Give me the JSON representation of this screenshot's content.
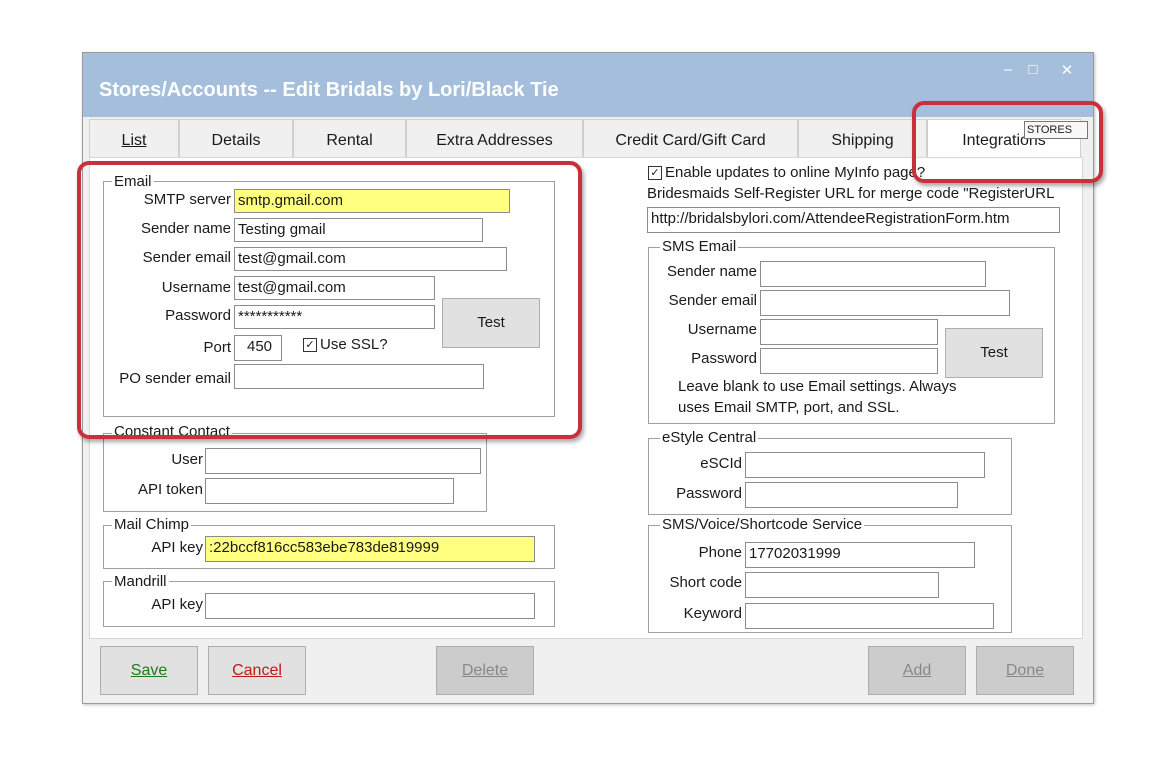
{
  "window": {
    "title": "Stores/Accounts -- Edit Bridals by Lori/Black Tie",
    "minimize_glyph": "–",
    "maximize_glyph": "□",
    "close_glyph": "✕"
  },
  "tabs": [
    {
      "label": "List"
    },
    {
      "label": "Details"
    },
    {
      "label": "Rental"
    },
    {
      "label": "Extra Addresses"
    },
    {
      "label": "Credit Card/Gift Card"
    },
    {
      "label": "Shipping"
    },
    {
      "label": "Integrations"
    }
  ],
  "tooltip": "STORES",
  "email": {
    "group_label": "Email",
    "smtp_label": "SMTP server",
    "smtp_value": "smtp.gmail.com",
    "sender_name_label": "Sender name",
    "sender_name_value": "Testing gmail",
    "sender_email_label": "Sender email",
    "sender_email_value": "test@gmail.com",
    "username_label": "Username",
    "username_value": "test@gmail.com",
    "password_label": "Password",
    "password_value": "***********",
    "test_label": "Test",
    "port_label": "Port",
    "port_value": "450",
    "ssl_label": "Use SSL?",
    "ssl_checked": true,
    "po_label": "PO sender email",
    "po_value": ""
  },
  "constant_contact": {
    "group_label": "Constant Contact",
    "user_label": "User",
    "user_value": "",
    "token_label": "API token",
    "token_value": ""
  },
  "mailchimp": {
    "group_label": "Mail Chimp",
    "key_label": "API key",
    "key_value": ":22bccf816cc583ebe783de819999"
  },
  "mandrill": {
    "group_label": "Mandrill",
    "key_label": "API key",
    "key_value": ""
  },
  "myinfo": {
    "enable_label": "Enable updates to online MyInfo page?",
    "enable_checked": true,
    "url_label": "Bridesmaids Self-Register URL for merge code \"RegisterURL",
    "url_value": "http://bridalsbylori.com/AttendeeRegistrationForm.htm"
  },
  "sms_email": {
    "group_label": "SMS Email",
    "sender_name_label": "Sender name",
    "sender_email_label": "Sender email",
    "username_label": "Username",
    "password_label": "Password",
    "test_label": "Test",
    "note_line1": "Leave blank to use Email settings.  Always",
    "note_line2": "uses Email SMTP, port, and SSL."
  },
  "estyle": {
    "group_label": "eStyle Central",
    "id_label": "eSCId",
    "password_label": "Password"
  },
  "sms_service": {
    "group_label": "SMS/Voice/Shortcode Service",
    "phone_label": "Phone",
    "phone_value": "17702031999",
    "shortcode_label": "Short code",
    "keyword_label": "Keyword"
  },
  "buttons": {
    "save": "Save",
    "cancel": "Cancel",
    "delete": "Delete",
    "add": "Add",
    "done": "Done"
  },
  "colors": {
    "titlebar": "#a4bedb",
    "highlight_field": "#ffff80",
    "annotation_red": "#c9303e"
  }
}
